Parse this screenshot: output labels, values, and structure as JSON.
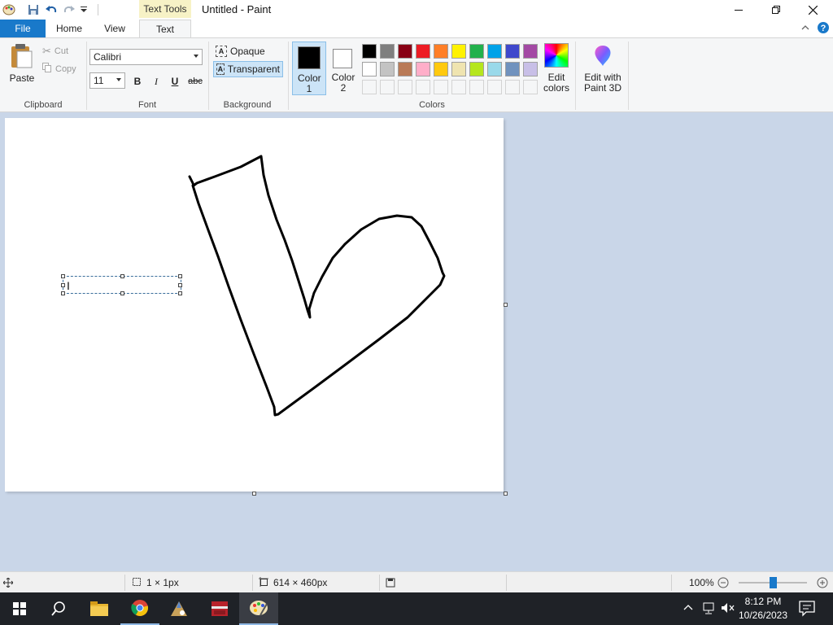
{
  "window": {
    "title": "Untitled - Paint",
    "contextual_tab": "Text Tools"
  },
  "tabs": {
    "file": "File",
    "home": "Home",
    "view": "View",
    "text": "Text"
  },
  "clipboard": {
    "paste": "Paste",
    "cut": "Cut",
    "copy": "Copy",
    "group": "Clipboard"
  },
  "font": {
    "name": "Calibri",
    "size": "11",
    "bold": "B",
    "italic": "I",
    "underline": "U",
    "strikethrough": "abc",
    "group": "Font"
  },
  "background": {
    "opaque": "Opaque",
    "transparent": "Transparent",
    "group": "Background"
  },
  "colors": {
    "color1_label": "Color 1",
    "color2_label": "Color 2",
    "color1": "#000000",
    "color2": "#ffffff",
    "palette": [
      "#000000",
      "#7f7f7f",
      "#880015",
      "#ed1c24",
      "#ff7f27",
      "#fff200",
      "#22b14c",
      "#00a2e8",
      "#3f48cc",
      "#a349a4",
      "#ffffff",
      "#c3c3c3",
      "#b97a57",
      "#ffaec9",
      "#ffc90e",
      "#efe4b0",
      "#b5e61d",
      "#99d9ea",
      "#7092be",
      "#c8bfe7"
    ],
    "edit_colors": "Edit colors",
    "edit_paint3d": "Edit with Paint 3D",
    "group": "Colors"
  },
  "status": {
    "selection_size": "1 × 1px",
    "canvas_size": "614 × 460px",
    "zoom": "100%",
    "zoom_level": 0.5
  },
  "taskbar": {
    "time": "8:12 PM",
    "date": "10/26/2023"
  }
}
